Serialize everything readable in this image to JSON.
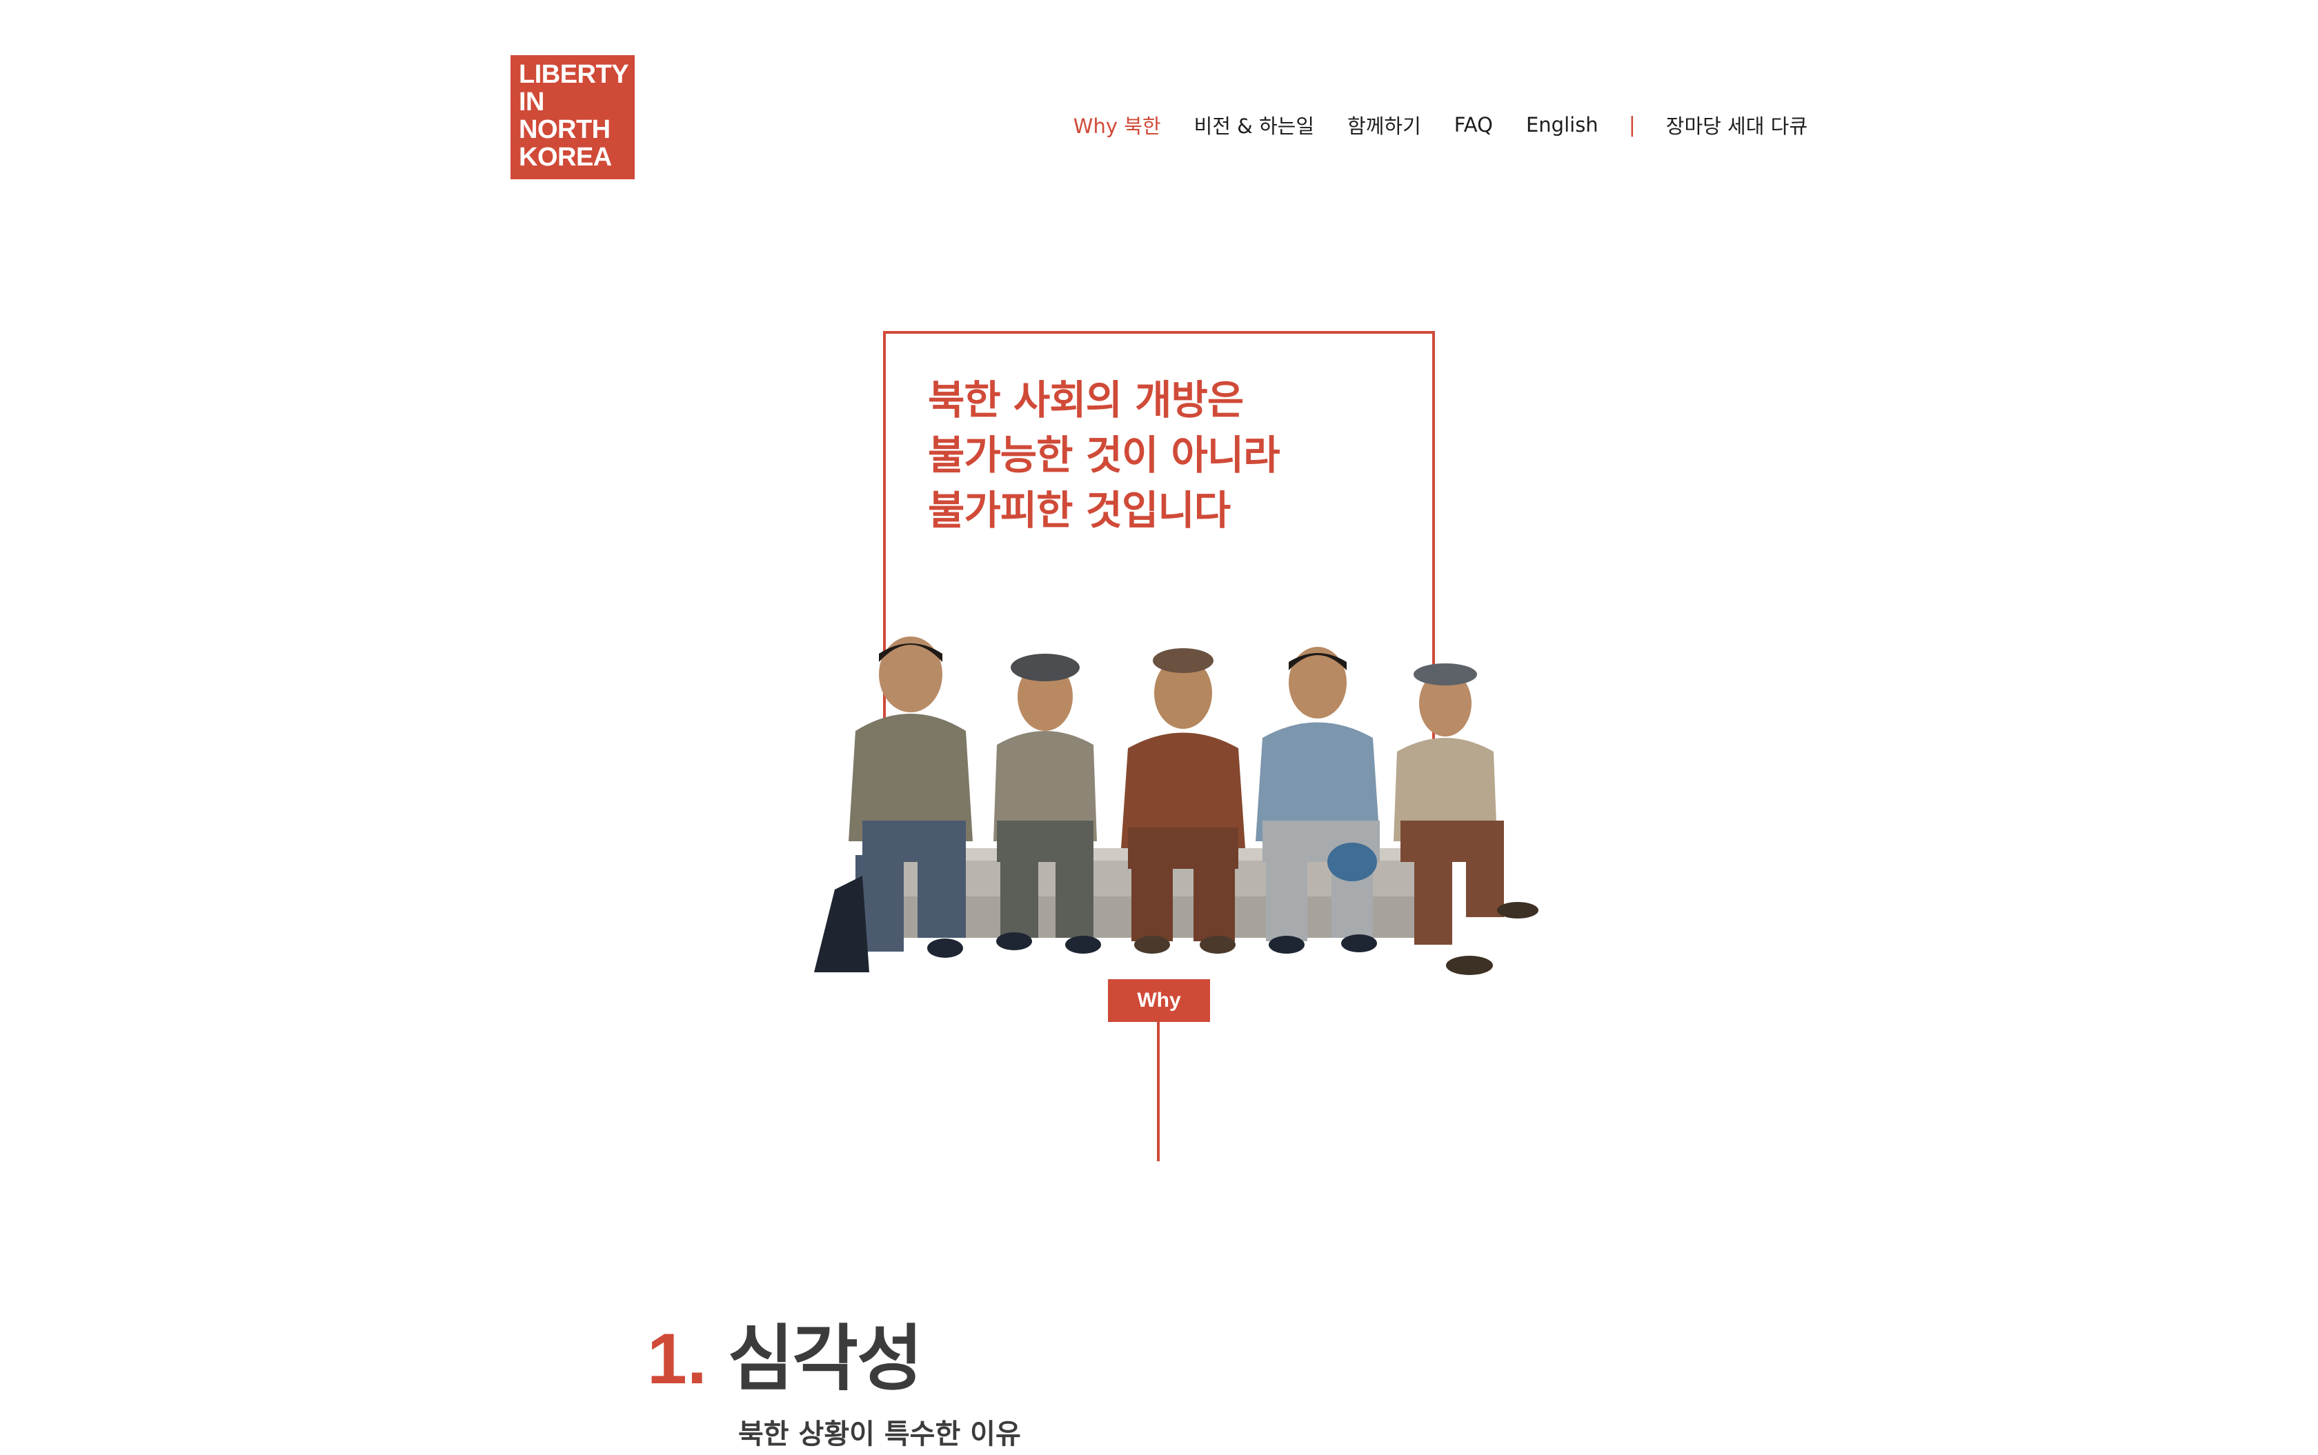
{
  "brand": {
    "logo_lines": [
      "LIBERTY",
      "IN",
      "NORTH",
      "KOREA"
    ],
    "color": "#d04a38"
  },
  "nav": {
    "items": [
      "Why 북한",
      "비전 & 하는일",
      "함께하기",
      "FAQ",
      "English"
    ],
    "active_item": "Why 북한",
    "divider": "|",
    "doc_link": "장마당 세대 다큐"
  },
  "hero": {
    "headline_lines": [
      "북한 사회의 개방은",
      "불가능한 것이 아니라",
      "불가피한 것입니다"
    ],
    "photo_subject": "five men sitting on a concrete step",
    "tag_label": "Why"
  },
  "section1": {
    "number": "1.",
    "title": "심각성",
    "subtitle": "북한 상황이 특수한 이유"
  }
}
